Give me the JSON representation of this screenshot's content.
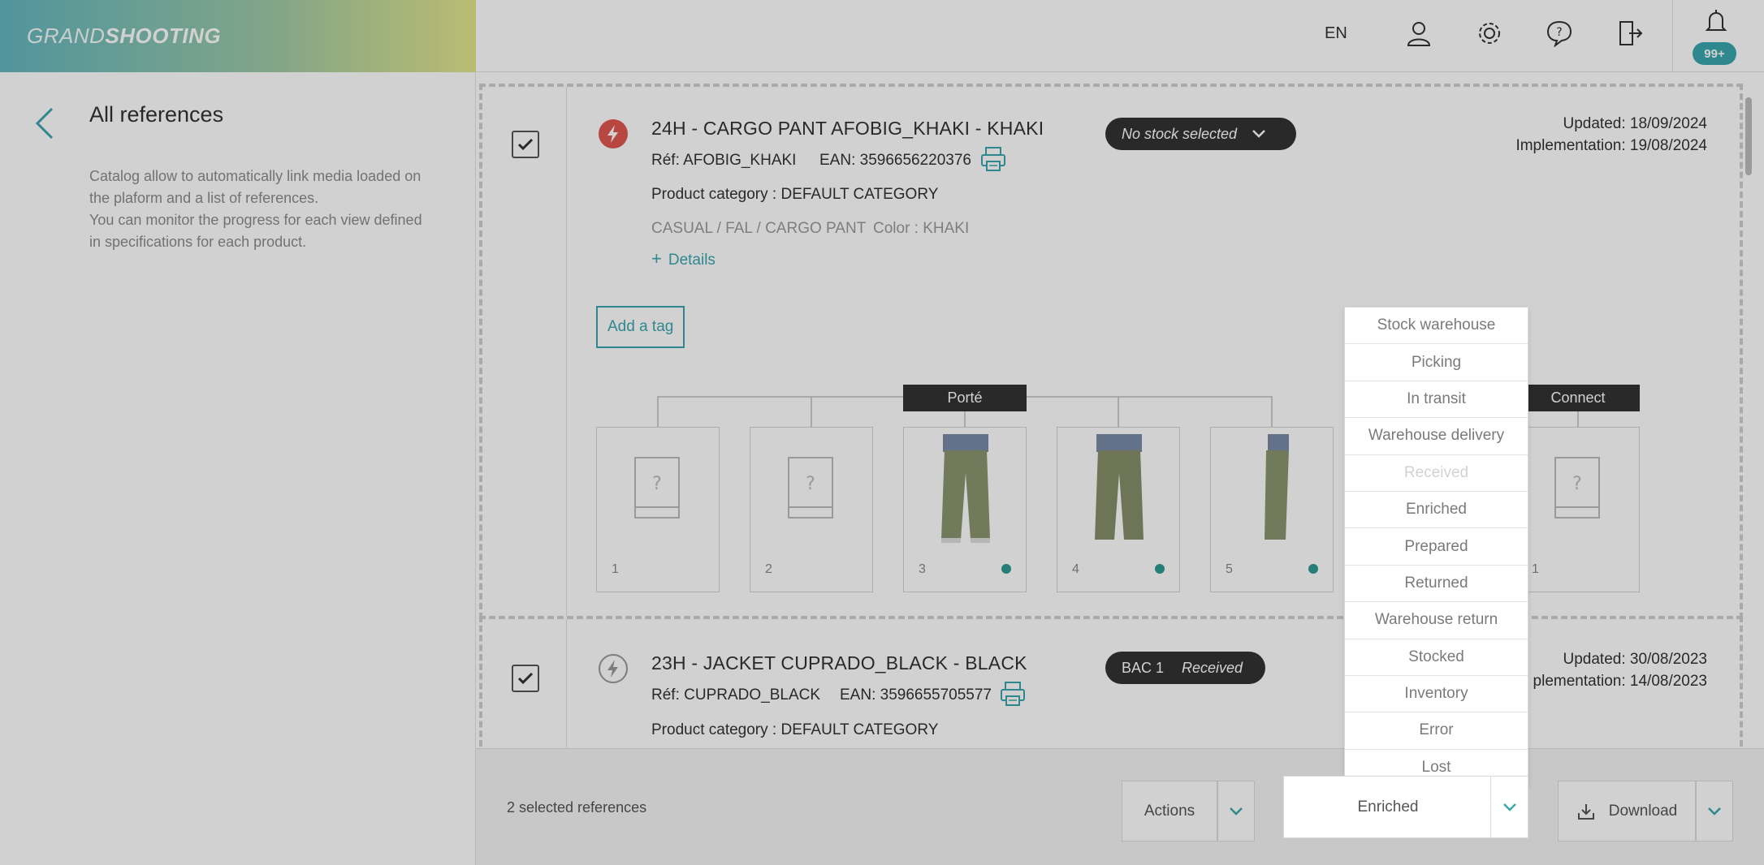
{
  "brand": {
    "part1": "GRAND",
    "part2": "SHOOTING"
  },
  "left": {
    "title": "All references",
    "description_lines": [
      "Catalog allow to automatically link media loaded on",
      "the plaform and a list of references.",
      "You can monitor the progress for each view defined",
      "in specifications for each product."
    ]
  },
  "topbar": {
    "language": "EN",
    "notification_count": "99+"
  },
  "references": [
    {
      "title": "24H   -   CARGO PANT AFOBIG_KHAKI   -   KHAKI",
      "ref": "Réf: AFOBIG_KHAKI",
      "ean": "EAN: 3596656220376",
      "category": "Product category : DEFAULT CATEGORY",
      "path": "CASUAL / FAL / CARGO PANT",
      "color": "Color : KHAKI",
      "details_label": "Details",
      "stock_label": "No stock selected",
      "updated": "Updated: 18/09/2024",
      "implementation": "Implementation: 19/08/2024",
      "add_tag_label": "Add a tag",
      "group_porte": "Porté",
      "group_connect": "Connect",
      "thumbs": [
        "1",
        "2",
        "3",
        "4",
        "5"
      ],
      "connect_thumb": "1"
    },
    {
      "title": "23H   -   JACKET CUPRADO_BLACK   -   BLACK",
      "ref": "Réf: CUPRADO_BLACK",
      "ean": "EAN: 3596655705577",
      "category": "Product category : DEFAULT CATEGORY",
      "stock_bac": "BAC 1",
      "stock_status": "Received",
      "updated": "Updated: 30/08/2023",
      "implementation": "plementation: 14/08/2023"
    }
  ],
  "footer": {
    "selected_count": "2 selected references",
    "actions_label": "Actions",
    "status_value": "Enriched",
    "download_label": "Download"
  },
  "status_options": [
    "Stock warehouse",
    "Picking",
    "In transit",
    "Warehouse delivery",
    "Received",
    "Enriched",
    "Prepared",
    "Returned",
    "Warehouse return",
    "Stocked",
    "Inventory",
    "Error",
    "Lost"
  ],
  "colors": {
    "accent": "#3aa6ad",
    "dark": "#333333",
    "lightning_active": "#e0574f"
  }
}
